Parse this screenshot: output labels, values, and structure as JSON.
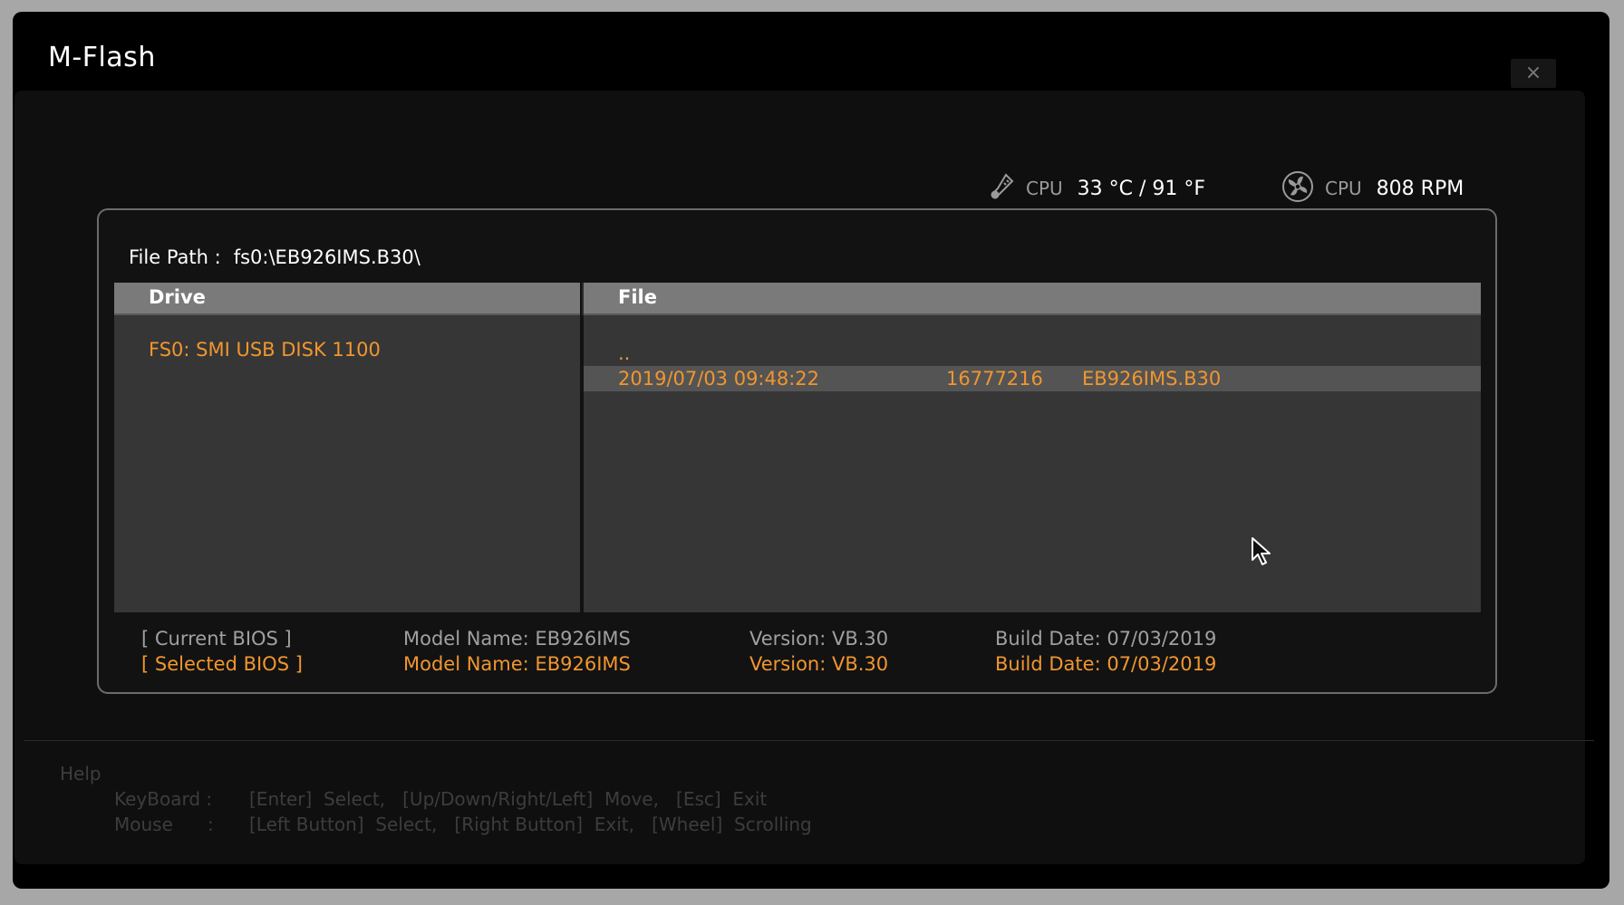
{
  "window": {
    "title": "M-Flash",
    "close_label": "×"
  },
  "hardware": {
    "cpu_temp_label": "CPU",
    "cpu_temp_value": "33 °C / 91 °F",
    "cpu_fan_label": "CPU",
    "cpu_fan_value": "808 RPM"
  },
  "file_path": {
    "label": "File Path :",
    "value": "fs0:\\EB926IMS.B30\\"
  },
  "drive_pane": {
    "header": "Drive",
    "items": [
      "FS0: SMI USB DISK 1100"
    ]
  },
  "file_pane": {
    "header": "File",
    "parent_entry": "..",
    "entries": [
      {
        "datetime": "2019/07/03 09:48:22",
        "size": "16777216",
        "name": "EB926IMS.B30"
      }
    ]
  },
  "bios": {
    "current": {
      "label": "[ Current BIOS   ]",
      "model": "Model Name: EB926IMS",
      "version": "Version: VB.30",
      "build_date": "Build Date: 07/03/2019"
    },
    "selected": {
      "label": "[ Selected BIOS ]",
      "model": "Model Name: EB926IMS",
      "version": "Version: VB.30",
      "build_date": "Build Date: 07/03/2019"
    }
  },
  "help": {
    "title": "Help",
    "keyboard_label": "KeyBoard :",
    "keyboard_text": "[Enter]  Select,   [Up/Down/Right/Left]  Move,   [Esc]  Exit",
    "mouse_label": "Mouse      :",
    "mouse_text": "[Left Button]  Select,   [Right Button]  Exit,   [Wheel]  Scrolling"
  },
  "colors": {
    "accent_orange": "#f1962f",
    "header_gray": "#7a7a7a",
    "pane_gray": "#363636"
  }
}
